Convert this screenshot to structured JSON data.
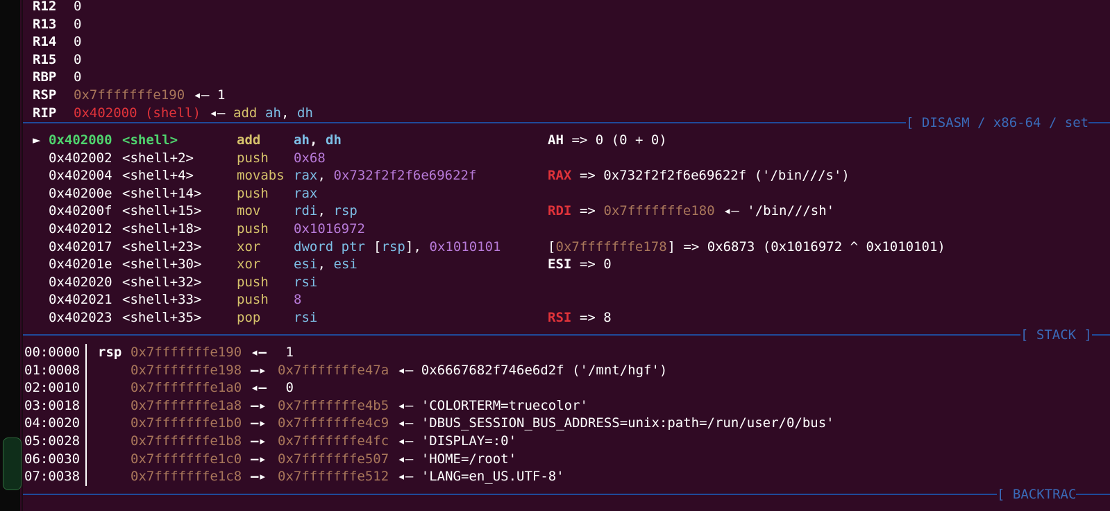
{
  "registers": [
    {
      "name": "R12",
      "value": "0"
    },
    {
      "name": "R13",
      "value": "0"
    },
    {
      "name": "R14",
      "value": "0"
    },
    {
      "name": "R15",
      "value": "0"
    },
    {
      "name": "RBP",
      "value": "0"
    },
    {
      "name": "RSP",
      "value": "0x7fffffffe190",
      "arrow": "◂—",
      "deref": "1"
    },
    {
      "name": "RIP",
      "value": "0x402000 (shell)",
      "arrow": "◂—",
      "mnemonic": "add",
      "op1": "ah",
      "comma": ",",
      "op2": "dh"
    }
  ],
  "disasm_header": "[ DISASM / x86-64 / set",
  "disasm": [
    {
      "marker": "►",
      "addr": "0x402000",
      "sym": "<shell>",
      "mn": "add",
      "ops": [
        {
          "t": "ah",
          "c": "cyan"
        },
        {
          "t": ", ",
          "c": "white"
        },
        {
          "t": "dh",
          "c": "cyan"
        }
      ],
      "ann": [
        {
          "t": "AH",
          "c": "whiteb"
        },
        {
          "t": " => 0 (0 + 0)",
          "c": "white"
        }
      ]
    },
    {
      "marker": "",
      "addr": "0x402002",
      "sym": "<shell+2>",
      "mn": "push",
      "ops": [
        {
          "t": "0x68",
          "c": "purple"
        }
      ],
      "ann": []
    },
    {
      "marker": "",
      "addr": "0x402004",
      "sym": "<shell+4>",
      "mn": "movabs",
      "ops": [
        {
          "t": "rax",
          "c": "cyan"
        },
        {
          "t": ", ",
          "c": "white"
        },
        {
          "t": "0x732f2f2f6e69622f",
          "c": "purple"
        }
      ],
      "ann": [
        {
          "t": "RAX",
          "c": "redb"
        },
        {
          "t": " => 0x732f2f2f6e69622f ('/bin///s')",
          "c": "white"
        }
      ]
    },
    {
      "marker": "",
      "addr": "0x40200e",
      "sym": "<shell+14>",
      "mn": "push",
      "ops": [
        {
          "t": "rax",
          "c": "cyan"
        }
      ],
      "ann": []
    },
    {
      "marker": "",
      "addr": "0x40200f",
      "sym": "<shell+15>",
      "mn": "mov",
      "ops": [
        {
          "t": "rdi",
          "c": "cyan"
        },
        {
          "t": ", ",
          "c": "white"
        },
        {
          "t": "rsp",
          "c": "cyan"
        }
      ],
      "ann": [
        {
          "t": "RDI",
          "c": "redb"
        },
        {
          "t": " => ",
          "c": "white"
        },
        {
          "t": "0x7fffffffe180",
          "c": "tan"
        },
        {
          "t": " ◂— '/bin///sh'",
          "c": "white"
        }
      ]
    },
    {
      "marker": "",
      "addr": "0x402012",
      "sym": "<shell+18>",
      "mn": "push",
      "ops": [
        {
          "t": "0x1016972",
          "c": "purple"
        }
      ],
      "ann": []
    },
    {
      "marker": "",
      "addr": "0x402017",
      "sym": "<shell+23>",
      "mn": "xor",
      "ops": [
        {
          "t": "dword ptr ",
          "c": "cyan"
        },
        {
          "t": "[",
          "c": "white"
        },
        {
          "t": "rsp",
          "c": "cyan"
        },
        {
          "t": "], ",
          "c": "white"
        },
        {
          "t": "0x1010101",
          "c": "purple"
        }
      ],
      "ann": [
        {
          "t": "[",
          "c": "white"
        },
        {
          "t": "0x7fffffffe178",
          "c": "tan"
        },
        {
          "t": "] => 0x6873 (0x1016972 ^ 0x1010101)",
          "c": "white"
        }
      ]
    },
    {
      "marker": "",
      "addr": "0x40201e",
      "sym": "<shell+30>",
      "mn": "xor",
      "ops": [
        {
          "t": "esi",
          "c": "cyan"
        },
        {
          "t": ", ",
          "c": "white"
        },
        {
          "t": "esi",
          "c": "cyan"
        }
      ],
      "ann": [
        {
          "t": "ESI",
          "c": "whiteb"
        },
        {
          "t": " => 0",
          "c": "white"
        }
      ]
    },
    {
      "marker": "",
      "addr": "0x402020",
      "sym": "<shell+32>",
      "mn": "push",
      "ops": [
        {
          "t": "rsi",
          "c": "cyan"
        }
      ],
      "ann": []
    },
    {
      "marker": "",
      "addr": "0x402021",
      "sym": "<shell+33>",
      "mn": "push",
      "ops": [
        {
          "t": "8",
          "c": "purple"
        }
      ],
      "ann": []
    },
    {
      "marker": "",
      "addr": "0x402023",
      "sym": "<shell+35>",
      "mn": "pop",
      "ops": [
        {
          "t": "rsi",
          "c": "cyan"
        }
      ],
      "ann": [
        {
          "t": "RSI",
          "c": "redb"
        },
        {
          "t": " => 8",
          "c": "white"
        }
      ]
    }
  ],
  "stack_header": "[ STACK ]",
  "stack": [
    {
      "idx": "00:0000",
      "reg": "rsp",
      "addr": "0x7fffffffe190",
      "arrow": "◂—",
      "ptr": "",
      "tail": " 1"
    },
    {
      "idx": "01:0008",
      "reg": "",
      "addr": "0x7fffffffe198",
      "arrow": "—▸",
      "ptr": "0x7fffffffe47a",
      "tail": " ◂— 0x6667682f746e6d2f ('/mnt/hgf')"
    },
    {
      "idx": "02:0010",
      "reg": "",
      "addr": "0x7fffffffe1a0",
      "arrow": "◂—",
      "ptr": "",
      "tail": " 0"
    },
    {
      "idx": "03:0018",
      "reg": "",
      "addr": "0x7fffffffe1a8",
      "arrow": "—▸",
      "ptr": "0x7fffffffe4b5",
      "tail": " ◂— 'COLORTERM=truecolor'"
    },
    {
      "idx": "04:0020",
      "reg": "",
      "addr": "0x7fffffffe1b0",
      "arrow": "—▸",
      "ptr": "0x7fffffffe4c9",
      "tail": " ◂— 'DBUS_SESSION_BUS_ADDRESS=unix:path=/run/user/0/bus'"
    },
    {
      "idx": "05:0028",
      "reg": "",
      "addr": "0x7fffffffe1b8",
      "arrow": "—▸",
      "ptr": "0x7fffffffe4fc",
      "tail": " ◂— 'DISPLAY=:0'"
    },
    {
      "idx": "06:0030",
      "reg": "",
      "addr": "0x7fffffffe1c0",
      "arrow": "—▸",
      "ptr": "0x7fffffffe507",
      "tail": " ◂— 'HOME=/root'"
    },
    {
      "idx": "07:0038",
      "reg": "",
      "addr": "0x7fffffffe1c8",
      "arrow": "—▸",
      "ptr": "0x7fffffffe512",
      "tail": " ◂— 'LANG=en_US.UTF-8'"
    }
  ],
  "backtrace_header": "[ BACKTRAC"
}
